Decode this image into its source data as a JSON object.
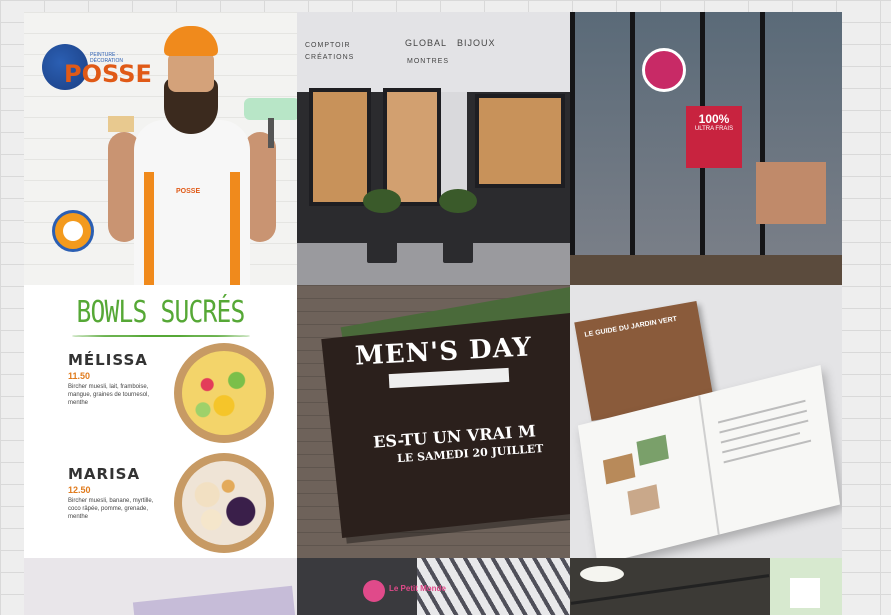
{
  "tiles": {
    "painter": {
      "logo_word": "POSSE",
      "logo_tag": "PEINTURE · DÉCORATION",
      "apron_word": "POSSE"
    },
    "shop": {
      "sign": [
        "COMPTOIR",
        "GLOBAL",
        "BIJOUX",
        "MONTRES",
        "CRÉATIONS"
      ]
    },
    "glass": {
      "poster_big": "100%",
      "poster_small": "ULTRA FRAIS"
    },
    "menu": {
      "title": "BOWLS SUCRÉS",
      "items": [
        {
          "name": "MÉLISSA",
          "price": "11.50",
          "desc": "Bircher muesli, lait, framboise, mangue, graines de tournesol, menthe"
        },
        {
          "name": "MARISA",
          "price": "12.50",
          "desc": "Bircher muesli, banane, myrtille, coco râpée, pomme, grenade, menthe"
        }
      ]
    },
    "mens": {
      "title": "MEN'S DAY",
      "line1": "ES-TU UN VRAI M",
      "line2": "LE SAMEDI 20 JUILLET"
    },
    "book": {
      "cover_text": "LE GUIDE DU JARDIN VERT"
    },
    "bottom_center": {
      "logo_text": "Le Petit Monde"
    }
  }
}
